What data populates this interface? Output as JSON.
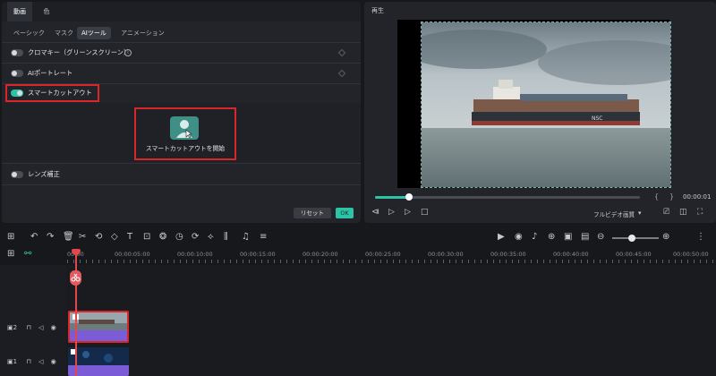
{
  "tabs": {
    "video": "動画",
    "color": "色"
  },
  "subtabs": {
    "basic": "ベーシック",
    "mask": "マスク",
    "ai": "AIツール",
    "anim": "アニメーション"
  },
  "features": {
    "chroma": "クロマキー（グリーンスクリーン）",
    "portrait": "AIポートレート",
    "cutout": "スマートカットアウト",
    "cutout_start": "スマートカットアウトを開始",
    "lens": "レンズ補正"
  },
  "buttons": {
    "reset": "リセット",
    "ok": "OK"
  },
  "player": {
    "title": "再生",
    "time": "00:00:01",
    "quality": "フルビデオ画質",
    "open_bracket": "{",
    "close_bracket": "}"
  },
  "ruler": [
    "00:00",
    "00:00:05:00",
    "00:00:10:00",
    "00:00:15:00",
    "00:00:20:00",
    "00:00:25:00",
    "00:00:30:00",
    "00:00:35:00",
    "00:00:40:00",
    "00:00:45:00",
    "00:00:50:00"
  ],
  "tracks": {
    "track2": "2",
    "track1": "1"
  },
  "playback": {
    "progress_fraction": 0.13
  },
  "colors": {
    "accent": "#2fc3a5",
    "highlight": "#d8262a",
    "playhead": "#e0484c"
  },
  "icons": [
    "undo-icon",
    "redo-icon",
    "delete-icon",
    "cut-icon",
    "crop-icon",
    "text-icon",
    "color-icon",
    "timer-icon",
    "speed-icon",
    "play-icon",
    "marker-icon",
    "mic-icon",
    "zoom-out-icon",
    "zoom-in-icon"
  ]
}
